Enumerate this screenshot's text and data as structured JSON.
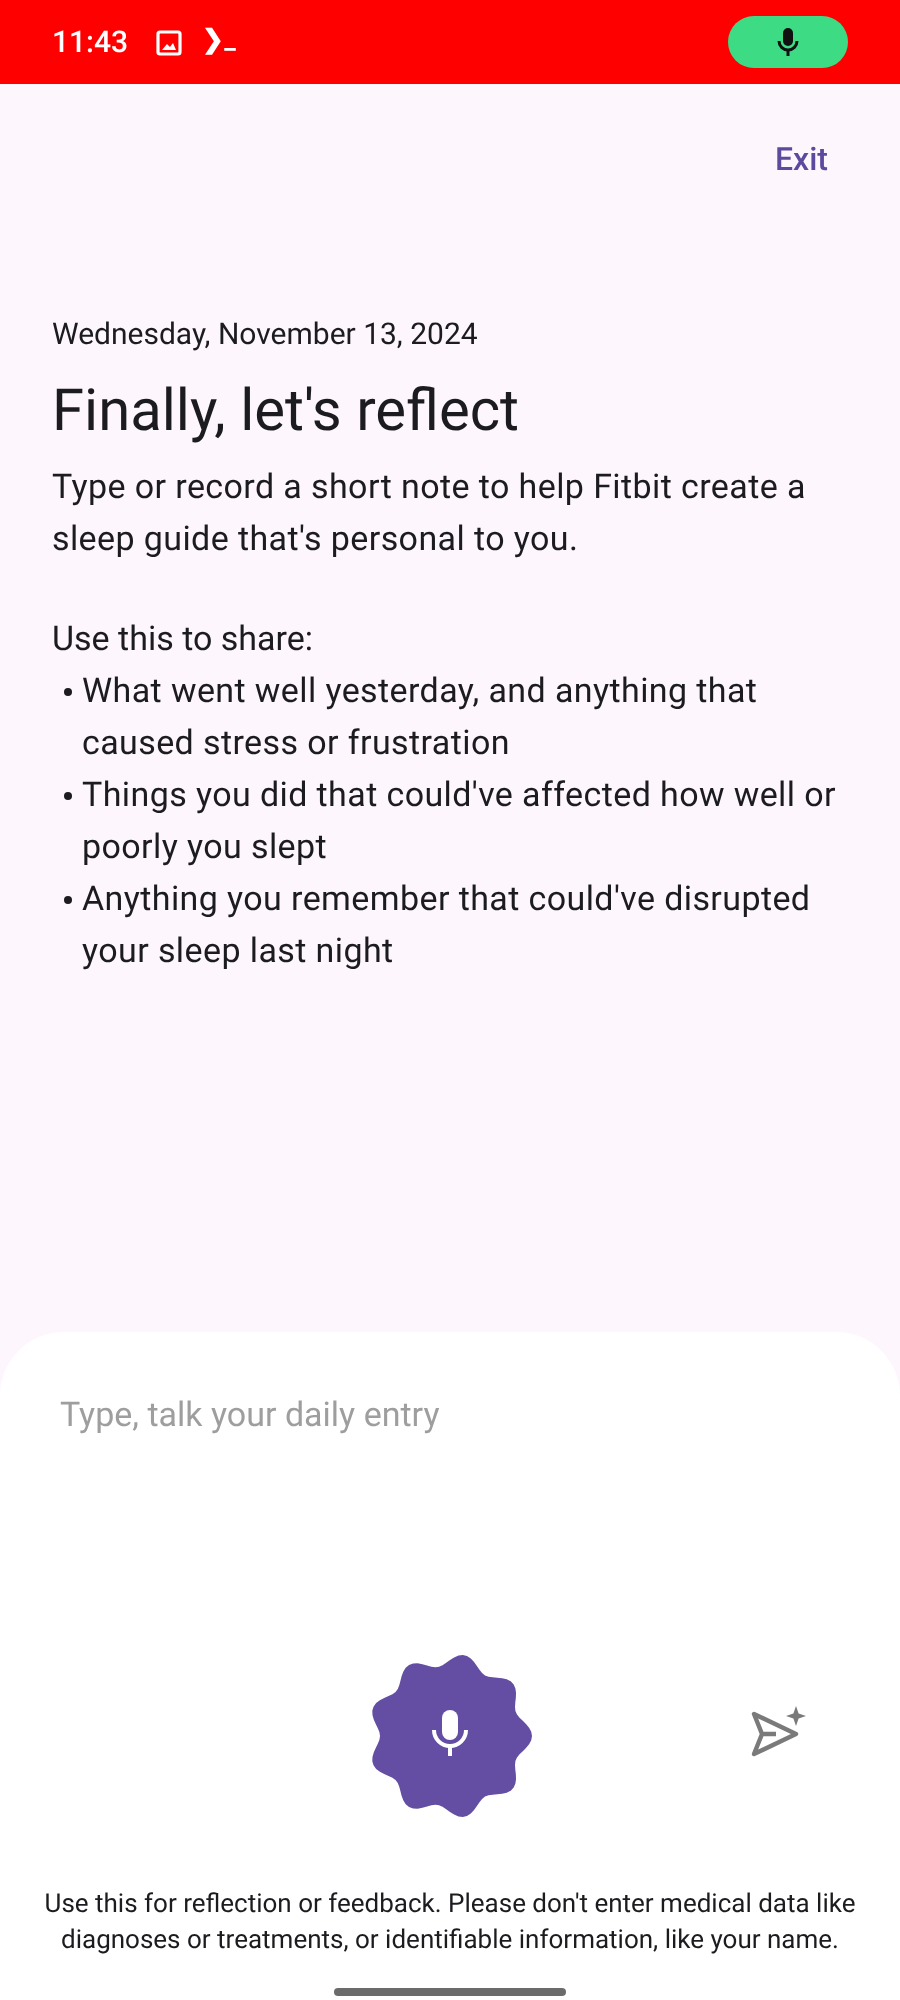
{
  "status_bar": {
    "time": "11:43",
    "terminal_glyph": "❯_"
  },
  "header": {
    "exit": "Exit"
  },
  "date": "Wednesday, November 13, 2024",
  "title": "Finally, let's reflect",
  "intro": "Type or record a short note to help Fitbit create a sleep guide that's personal to you.",
  "share_heading": "Use this to share:",
  "bullets": [
    "What went well yesterday, and anything that caused stress or frustration",
    "Things you did that could've affected how well or poorly you slept",
    "Anything you remember that could've disrupted your sleep last night"
  ],
  "entry": {
    "placeholder": "Type, talk your daily entry"
  },
  "disclaimer": "Use this for reflection or feedback. Please don't enter medical data like diagnoses or treatments, or identifiable information, like your name."
}
